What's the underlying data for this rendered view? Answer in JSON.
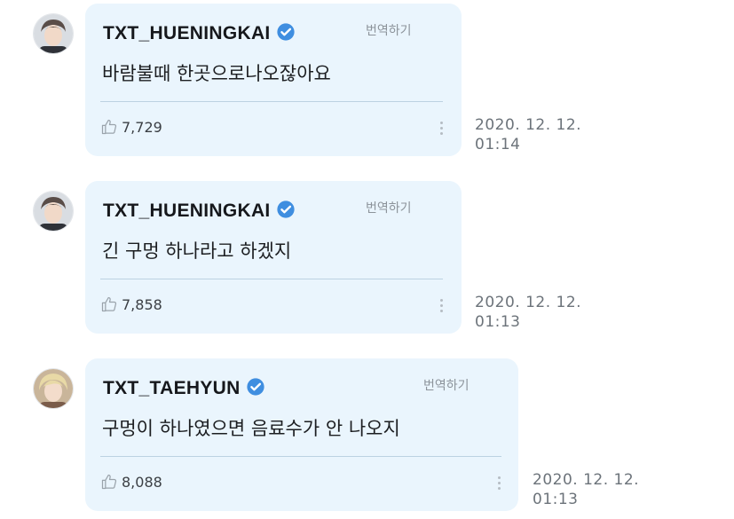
{
  "messages": [
    {
      "username": "TXT_HUENINGKAI",
      "translate_label": "번역하기",
      "text": "바람불때 한곳으로나오잖아요",
      "likes": "7,729",
      "time_date": "2020. 12. 12.",
      "time_clock": "01:14",
      "verified": true
    },
    {
      "username": "TXT_HUENINGKAI",
      "translate_label": "번역하기",
      "text": "긴 구멍 하나라고 하겠지",
      "likes": "7,858",
      "time_date": "2020. 12. 12.",
      "time_clock": "01:13",
      "verified": true
    },
    {
      "username": "TXT_TAEHYUN",
      "translate_label": "번역하기",
      "text": "구멍이 하나였으면 음료수가 안 나오지",
      "likes": "8,088",
      "time_date": "2020. 12. 12.",
      "time_clock": "01:13",
      "verified": true
    }
  ],
  "colors": {
    "bubble_background": "#eaf5fd",
    "verified_badge": "#3f8ee0",
    "secondary_text": "#8c939a"
  }
}
